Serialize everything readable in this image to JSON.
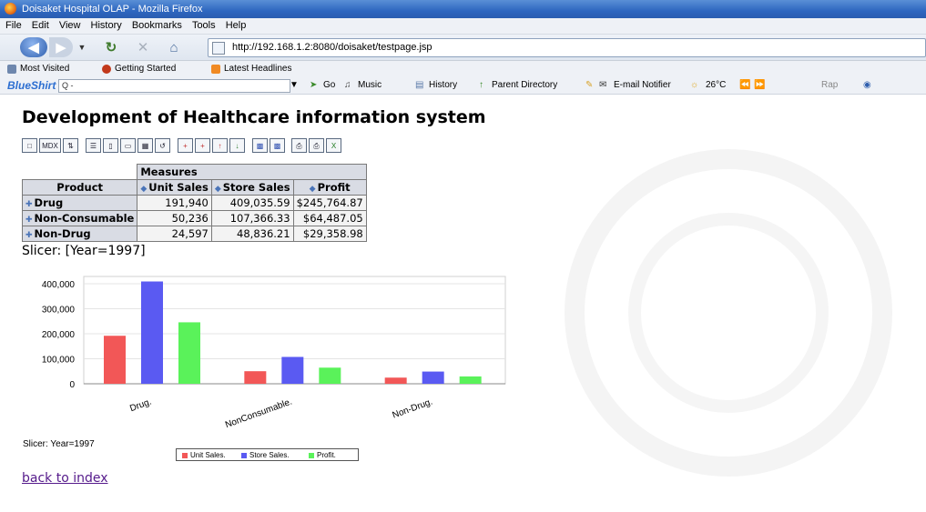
{
  "window": {
    "title": "Doisaket Hospital OLAP - Mozilla Firefox"
  },
  "menu": [
    "File",
    "Edit",
    "View",
    "History",
    "Bookmarks",
    "Tools",
    "Help"
  ],
  "nav": {
    "url": "http://192.168.1.2:8080/doisaket/testpage.jsp"
  },
  "bookmarks": [
    "Most Visited",
    "Getting Started",
    "Latest Headlines"
  ],
  "toolbar": {
    "brand": "BlueShirt",
    "search_placeholder": "Q -",
    "go": "Go",
    "music": "Music",
    "history": "History",
    "parent": "Parent Directory",
    "email": "E-mail Notifier",
    "temp": "26°C",
    "rap": "Rap"
  },
  "page": {
    "title": "Development of Healthcare information system",
    "olap_buttons": [
      "MDX"
    ],
    "slicer": "Slicer: [Year=1997]",
    "chart_slicer": "Slicer: Year=1997",
    "back_link": "back to index"
  },
  "pivot": {
    "measures_label": "Measures",
    "row_header": "Product",
    "columns": [
      "Unit Sales",
      "Store Sales",
      "Profit"
    ],
    "rows": [
      {
        "label": "Drug",
        "cells": [
          "191,940",
          "409,035.59",
          "$245,764.87"
        ]
      },
      {
        "label": "Non-Consumable",
        "cells": [
          "50,236",
          "107,366.33",
          "$64,487.05"
        ]
      },
      {
        "label": "Non-Drug",
        "cells": [
          "24,597",
          "48,836.21",
          "$29,358.98"
        ]
      }
    ]
  },
  "chart_data": {
    "type": "bar",
    "categories": [
      "Drug.",
      "NonConsumable.",
      "Non-Drug."
    ],
    "series": [
      {
        "name": "Unit Sales.",
        "values": [
          191940,
          50236,
          24597
        ],
        "color": "#f25757"
      },
      {
        "name": "Store Sales.",
        "values": [
          409035.59,
          107366.33,
          48836.21
        ],
        "color": "#5a5af2"
      },
      {
        "name": "Profit.",
        "values": [
          245764.87,
          64487.05,
          29358.98
        ],
        "color": "#5af25a"
      }
    ],
    "ylim": [
      0,
      400000
    ],
    "yticks": [
      "0",
      "100,000",
      "200,000",
      "300,000",
      "400,000"
    ],
    "legend": "bottom",
    "grid": true
  }
}
